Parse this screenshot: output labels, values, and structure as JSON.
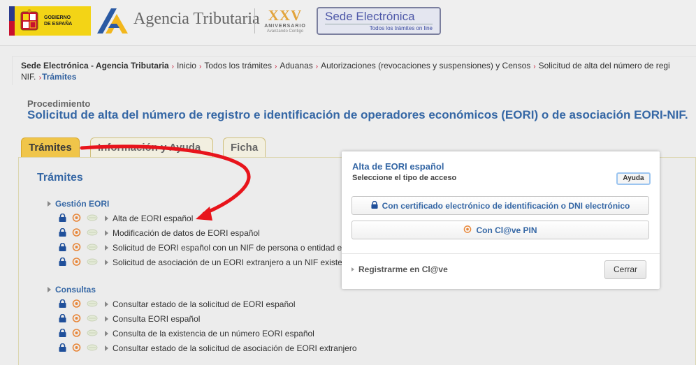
{
  "header": {
    "gobierno_line1": "GOBIERNO",
    "gobierno_line2": "DE ESPAÑA",
    "agency_name": "Agencia Tributaria",
    "anniversary_number": "XXV",
    "anniversary_label": "ANIVERSARIO",
    "anniversary_tagline": "Avanzando Contigo",
    "sede_title": "Sede Electrónica",
    "sede_subtitle": "Todos los trámites on line"
  },
  "breadcrumb": {
    "root": "Sede Electrónica - Agencia Tributaria",
    "items": [
      "Inicio",
      "Todos los trámites",
      "Aduanas",
      "Autorizaciones (revocaciones y suspensiones) y Censos",
      "Solicitud de alta del número de regi"
    ],
    "continuation": "NIF.",
    "current": "Trámites"
  },
  "procedure": {
    "label": "Procedimiento",
    "title": "Solicitud de alta del número de registro e identificación de operadores económicos (EORI) o de asociación EORI-NIF."
  },
  "tabs": [
    {
      "label": "Trámites",
      "active": true
    },
    {
      "label": "Información y Ayuda",
      "active": false
    },
    {
      "label": "Ficha",
      "active": false
    }
  ],
  "panel": {
    "heading": "Trámites",
    "sections": [
      {
        "title": "Gestión EORI",
        "items": [
          "Alta de EORI español",
          "Modificación de datos de EORI español",
          "Solicitud de EORI español con un NIF de persona o entidad ex",
          "Solicitud de asociación de un EORI extranjero a un NIF existen"
        ]
      },
      {
        "title": "Consultas",
        "items": [
          "Consultar estado de la solicitud de EORI español",
          "Consulta EORI español",
          "Consulta de la existencia de un número EORI español",
          "Consultar estado de la solicitud de asociación de EORI extranjero"
        ]
      }
    ]
  },
  "modal": {
    "title": "Alta de EORI español",
    "subtitle": "Seleccione el tipo de acceso",
    "help_button": "Ayuda",
    "cert_button": "Con certificado electrónico de identificación o DNI electrónico",
    "clave_button": "Con Cl@ve PIN",
    "register_link": "Registrarme en Cl@ve",
    "close_button": "Cerrar"
  },
  "colors": {
    "accent_blue": "#3567a5",
    "tab_active": "#f0c54a",
    "arrow_red": "#e8141b",
    "clave_orange": "#e8873a"
  },
  "icons": [
    "lock-icon",
    "clave-icon",
    "certificate-icon",
    "chevron-right-icon",
    "escudo-icon",
    "aeat-logo-icon"
  ]
}
